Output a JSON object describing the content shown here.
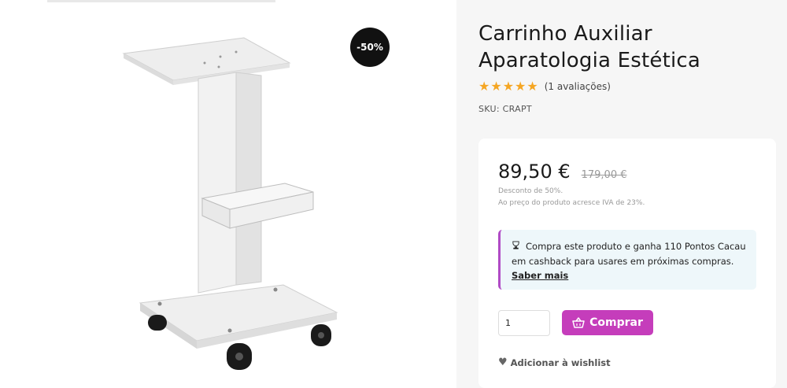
{
  "gallery": {
    "discount_badge": "-50%",
    "image_alt": "Carrinho Auxiliar Aparatologia Estética"
  },
  "product": {
    "title_line1": "Carrinho Auxiliar",
    "title_line2": "Aparatologia Estética",
    "rating_stars": 5,
    "rating_text": "(1 avaliações)",
    "sku": "SKU: CRAPT"
  },
  "purchase": {
    "price": "89,50 €",
    "old_price": "179,00 €",
    "discount_note": "Desconto de 50%.",
    "vat_note": "Ao preço do produto acresce IVA de 23%.",
    "cashback_text": "Compra este produto e ganha 110 Pontos Cacau em cashback para usares em próximas compras.",
    "cashback_link": "Saber mais",
    "quantity": "1",
    "buy_label": "Comprar",
    "wishlist_label": "Adicionar à wishlist"
  },
  "colors": {
    "accent": "#c53dbb",
    "star": "#f5a623",
    "cashback_bg": "#eef7fa"
  }
}
